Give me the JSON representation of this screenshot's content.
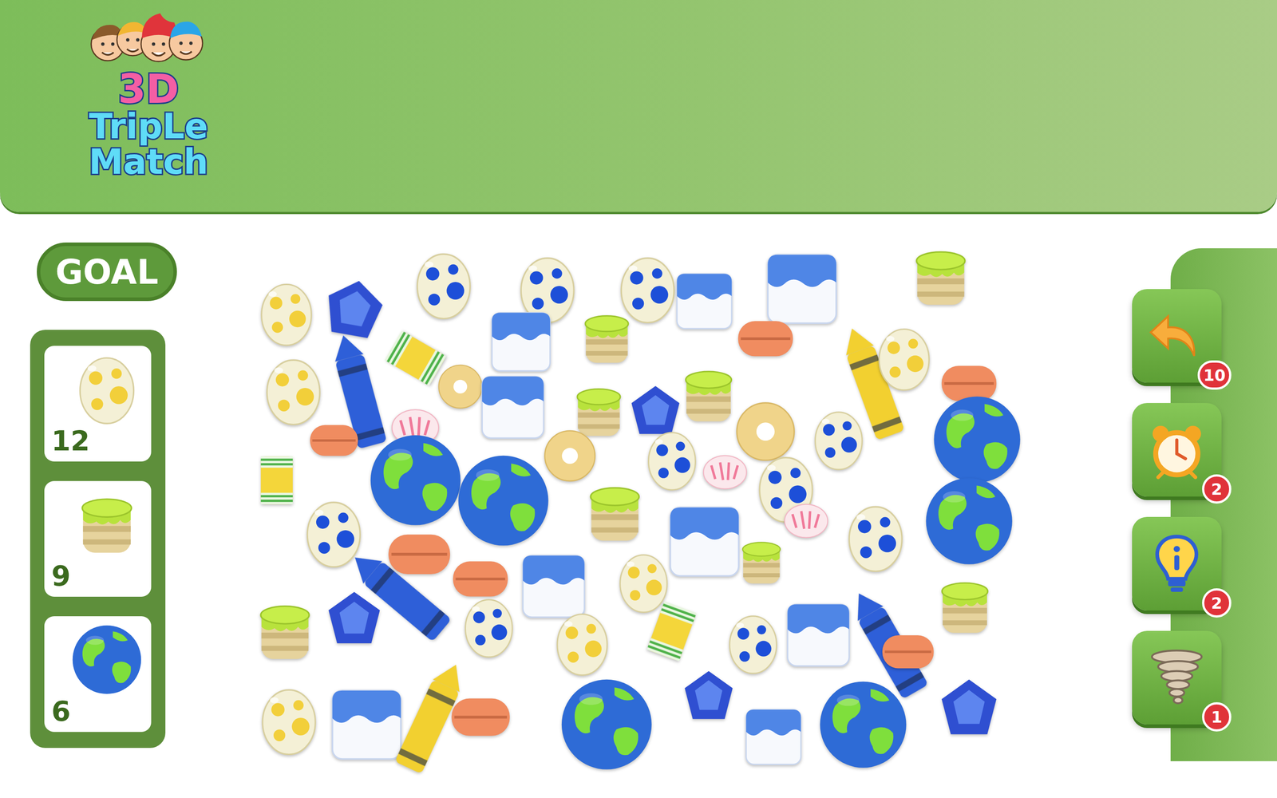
{
  "logo": {
    "line1": "3D",
    "line2": "TripLe",
    "line3": "Match"
  },
  "goal": {
    "title": "GOAL",
    "items": [
      {
        "kind": "yellow-egg",
        "count": "12"
      },
      {
        "kind": "jar",
        "count": "9"
      },
      {
        "kind": "earth",
        "count": "6"
      }
    ]
  },
  "board": {
    "items": [
      {
        "kind": "yellow-egg"
      },
      {
        "kind": "gem"
      },
      {
        "kind": "blue-egg"
      },
      {
        "kind": "cup"
      },
      {
        "kind": "blue-egg"
      },
      {
        "kind": "blue-egg"
      },
      {
        "kind": "cube"
      },
      {
        "kind": "cube"
      },
      {
        "kind": "jar"
      },
      {
        "kind": "crayon-blue"
      },
      {
        "kind": "yellow-egg"
      },
      {
        "kind": "cube"
      },
      {
        "kind": "jar"
      },
      {
        "kind": "macaron"
      },
      {
        "kind": "crayon-yellow"
      },
      {
        "kind": "yellow-egg"
      },
      {
        "kind": "macaron"
      },
      {
        "kind": "donut"
      },
      {
        "kind": "cube"
      },
      {
        "kind": "jar"
      },
      {
        "kind": "gem"
      },
      {
        "kind": "jar"
      },
      {
        "kind": "donut"
      },
      {
        "kind": "blue-egg"
      },
      {
        "kind": "earth"
      },
      {
        "kind": "macaron"
      },
      {
        "kind": "pink-donut"
      },
      {
        "kind": "donut"
      },
      {
        "kind": "blue-egg"
      },
      {
        "kind": "blue-egg"
      },
      {
        "kind": "cup"
      },
      {
        "kind": "earth"
      },
      {
        "kind": "earth"
      },
      {
        "kind": "pink-donut"
      },
      {
        "kind": "earth"
      },
      {
        "kind": "blue-egg"
      },
      {
        "kind": "jar"
      },
      {
        "kind": "pink-donut"
      },
      {
        "kind": "blue-egg"
      },
      {
        "kind": "macaron"
      },
      {
        "kind": "cube"
      },
      {
        "kind": "macaron"
      },
      {
        "kind": "cube"
      },
      {
        "kind": "yellow-egg"
      },
      {
        "kind": "jar"
      },
      {
        "kind": "jar"
      },
      {
        "kind": "crayon-blue"
      },
      {
        "kind": "jar"
      },
      {
        "kind": "gem"
      },
      {
        "kind": "blue-egg"
      },
      {
        "kind": "yellow-egg"
      },
      {
        "kind": "cup"
      },
      {
        "kind": "blue-egg"
      },
      {
        "kind": "cube"
      },
      {
        "kind": "crayon-blue"
      },
      {
        "kind": "macaron"
      },
      {
        "kind": "yellow-egg"
      },
      {
        "kind": "cube"
      },
      {
        "kind": "crayon-yellow"
      },
      {
        "kind": "macaron"
      },
      {
        "kind": "earth"
      },
      {
        "kind": "gem"
      },
      {
        "kind": "cube"
      },
      {
        "kind": "earth"
      },
      {
        "kind": "gem"
      }
    ]
  },
  "tools": [
    {
      "kind": "undo",
      "count": "10"
    },
    {
      "kind": "clock",
      "count": "2"
    },
    {
      "kind": "hint",
      "count": "2"
    },
    {
      "kind": "tornado",
      "count": "1"
    }
  ]
}
